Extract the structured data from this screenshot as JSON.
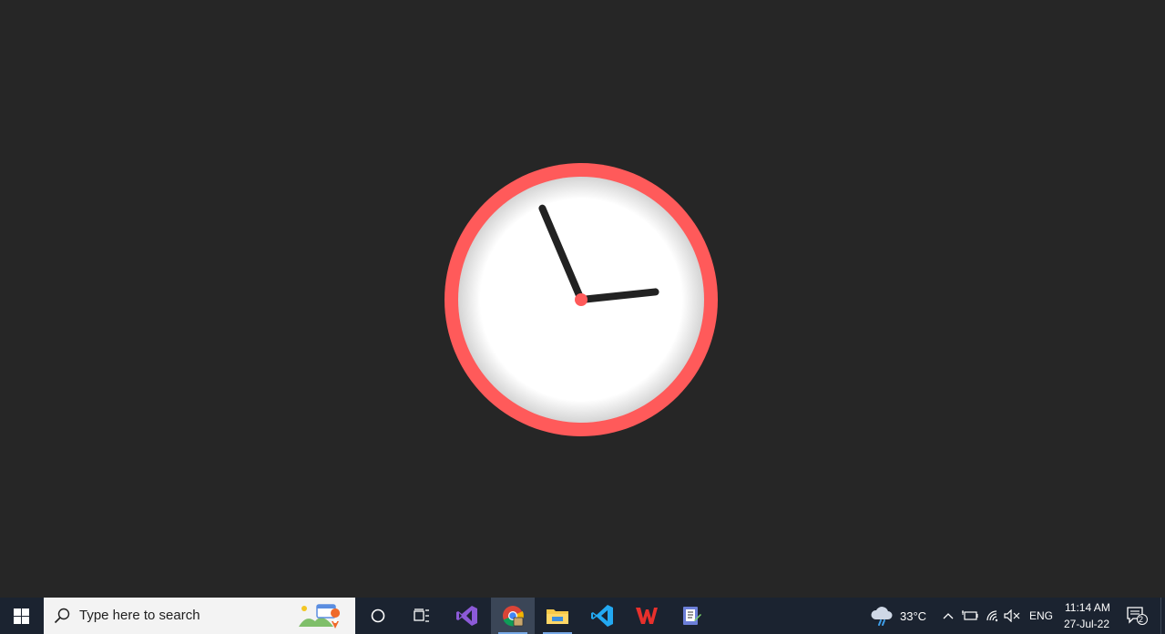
{
  "clock": {
    "hour": 11,
    "minute": 14,
    "colors": {
      "background": "#262626",
      "rim": "#ff5a5a",
      "face": "#ffffff",
      "hands": "#222222",
      "pivot": "#ff5a5a"
    }
  },
  "taskbar": {
    "start_icon": "windows-logo-icon",
    "search": {
      "placeholder": "Type here to search",
      "icon": "search-icon",
      "highlight_icon": "search-highlight-icon"
    },
    "apps": [
      {
        "name": "cortana",
        "icon": "cortana-circle-icon"
      },
      {
        "name": "task-view",
        "icon": "task-view-icon"
      },
      {
        "name": "visual-studio",
        "icon": "visual-studio-icon"
      },
      {
        "name": "chrome",
        "icon": "chrome-icon",
        "active": true
      },
      {
        "name": "file-explorer",
        "icon": "folder-icon"
      },
      {
        "name": "vscode",
        "icon": "vscode-icon"
      },
      {
        "name": "wps-office",
        "icon": "wps-icon"
      },
      {
        "name": "notepad-plus",
        "icon": "app-icon"
      }
    ],
    "tray": {
      "weather_icon": "cloud-rain-icon",
      "temperature": "33°C",
      "language": "ENG",
      "time": "11:14 AM",
      "date": "27-Jul-22",
      "notification_count": "2"
    }
  }
}
